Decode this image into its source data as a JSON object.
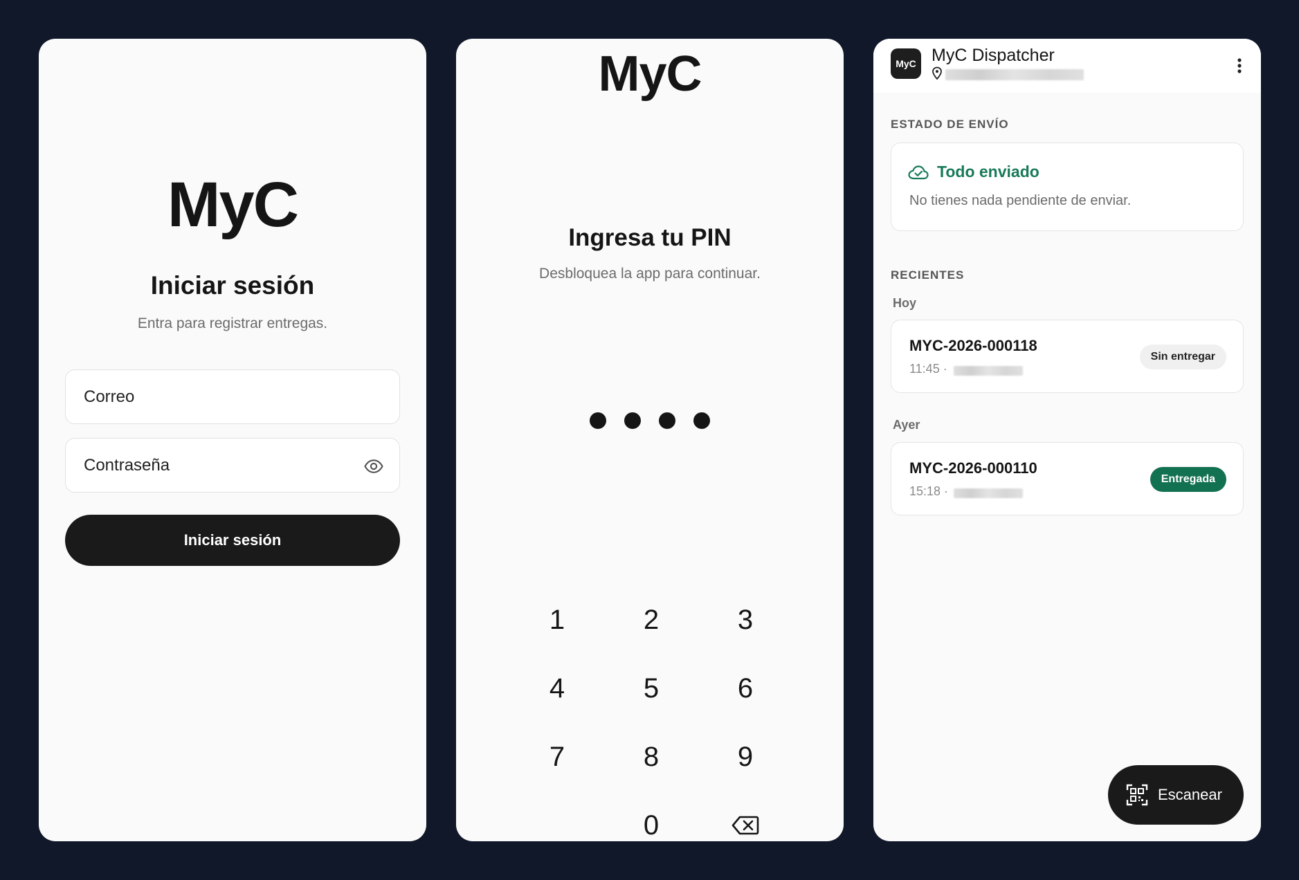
{
  "login": {
    "logo": "MyC",
    "title": "Iniciar sesión",
    "subtitle": "Entra para registrar entregas.",
    "email_placeholder": "Correo",
    "password_placeholder": "Contraseña",
    "submit_label": "Iniciar sesión"
  },
  "pin": {
    "logo": "MyC",
    "title": "Ingresa tu PIN",
    "subtitle": "Desbloquea la app para continuar.",
    "filled_digits": 4,
    "keys": [
      "1",
      "2",
      "3",
      "4",
      "5",
      "6",
      "7",
      "8",
      "9",
      "0"
    ]
  },
  "home": {
    "avatar_text": "MyC",
    "app_title": "MyC Dispatcher",
    "status_section_label": "ESTADO DE ENVÍO",
    "status_title": "Todo enviado",
    "status_text": "No tienes nada pendiente de enviar.",
    "recent_section_label": "RECIENTES",
    "groups": [
      {
        "label": "Hoy",
        "order": {
          "id": "MYC-2026-000118",
          "time": "11:45 ·",
          "status": "Sin entregar"
        }
      },
      {
        "label": "Ayer",
        "order": {
          "id": "MYC-2026-000110",
          "time": "15:18 ·",
          "status": "Entregada"
        }
      }
    ],
    "scan_label": "Escanear"
  },
  "colors": {
    "background": "#11182a",
    "screen": "#fafafa",
    "primary_dark": "#1a1a1a",
    "success_text": "#197a5a",
    "success_badge": "#127150"
  },
  "icons": [
    "eye-icon",
    "backspace-icon",
    "location-pin-icon",
    "more-vert-icon",
    "cloud-check-icon",
    "qr-scan-icon"
  ]
}
